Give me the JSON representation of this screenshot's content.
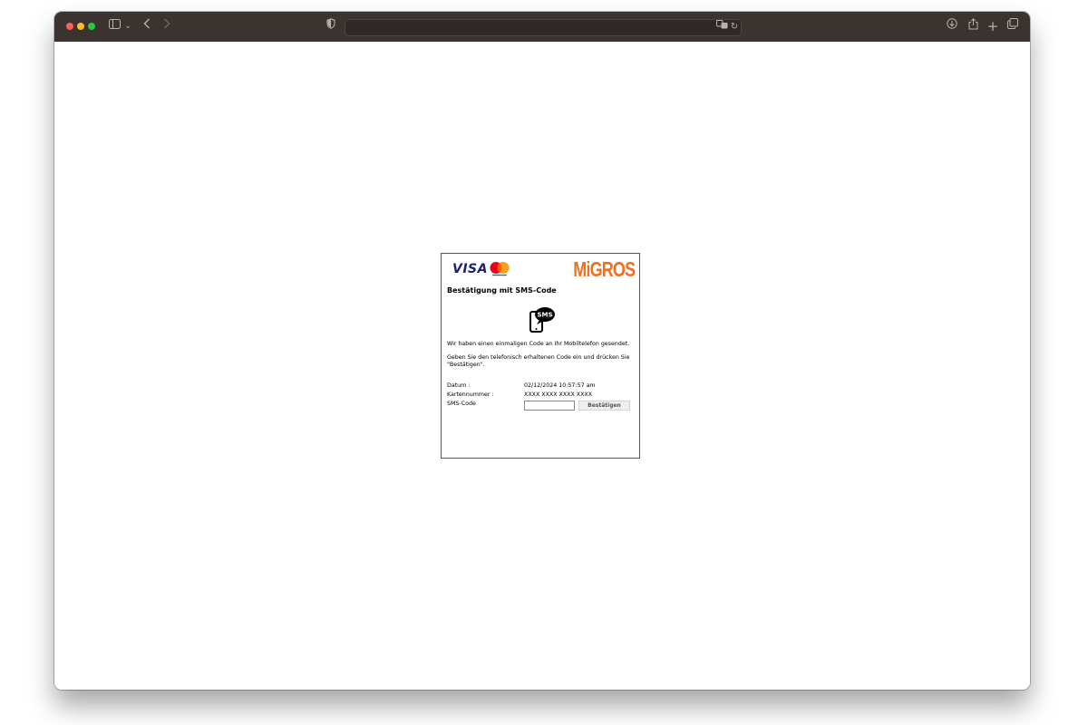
{
  "browser": {
    "window_colors": {
      "close": "#ff5f57",
      "minimize": "#febc2e",
      "zoom": "#28c840"
    },
    "icons": [
      "sidebar-icon",
      "chevron-down-icon",
      "back-icon",
      "forward-icon",
      "shield-icon",
      "translate-icon",
      "reload-icon",
      "download-icon",
      "share-icon",
      "new-tab-icon",
      "tab-overview-icon"
    ],
    "address": ""
  },
  "card": {
    "visa_label": "VISA",
    "migros_label": "MiGROS",
    "title": "Bestätigung mit SMS-Code",
    "sms_icon_label": "SMS",
    "message1": "Wir haben einen einmaligen Code an Ihr Mobiltelefon gesendet.",
    "message2": "Geben Sie den telefonisch erhaltenen Code ein und drücken Sie \"Bestätigen\".",
    "rows": [
      {
        "label": "Datum :",
        "value": "02/12/2024 10:57:57 am"
      },
      {
        "label": "Kartennummer :",
        "value": "XXXX XXXX XXXX XXXX"
      }
    ],
    "sms_code_label": "SMS-Code",
    "sms_code_value": "",
    "confirm_label": "Bestätigen"
  },
  "colors": {
    "migros_orange": "#f26f21",
    "visa_blue": "#1a1f71",
    "mastercard_red": "#eb001b",
    "mastercard_yellow": "#f79e1b"
  }
}
